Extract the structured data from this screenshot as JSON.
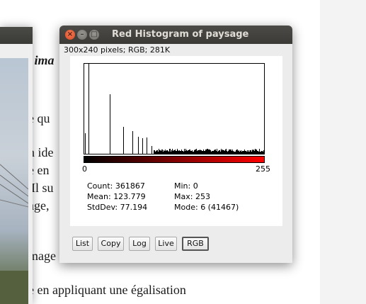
{
  "document": {
    "lines": [
      {
        "text": "- ima",
        "style": "bold-italic"
      },
      {
        "text": "e qu",
        "style": ""
      },
      {
        "text": "n  ide",
        "style": ""
      },
      {
        "text": "e en",
        "style": ""
      },
      {
        "text": " Il su",
        "style": ""
      },
      {
        "text": "age,",
        "style": ""
      },
      {
        "text": "mage",
        "style": ""
      },
      {
        "text": "e en appliquant  une égalisation",
        "style": ""
      }
    ]
  },
  "window": {
    "title": "Red Histogram of paysage",
    "info": "300x240 pixels; RGB; 281K"
  },
  "histogram": {
    "axis_min": "0",
    "axis_max": "255",
    "ramp_colors": [
      "#000000",
      "#ff0000"
    ],
    "spikes": [
      {
        "bin": 1,
        "level": 0.23
      },
      {
        "bin": 6,
        "level": 1.0
      },
      {
        "bin": 36,
        "level": 0.66
      },
      {
        "bin": 55,
        "level": 0.3
      },
      {
        "bin": 68,
        "level": 0.25
      },
      {
        "bin": 76,
        "level": 0.19
      },
      {
        "bin": 82,
        "level": 0.17
      },
      {
        "bin": 88,
        "level": 0.18
      },
      {
        "bin": 95,
        "level": 0.09
      }
    ]
  },
  "stats": {
    "count_label": "Count:",
    "count_value": "361867",
    "mean_label": "Mean:",
    "mean_value": "123.779",
    "stddev_label": "StdDev:",
    "stddev_value": "77.194",
    "min_label": "Min:",
    "min_value": "0",
    "max_label": "Max:",
    "max_value": "253",
    "mode_label": "Mode:",
    "mode_value": "6 (41467)"
  },
  "buttons": {
    "list": "List",
    "copy": "Copy",
    "log": "Log",
    "live": "Live",
    "rgb": "RGB"
  }
}
